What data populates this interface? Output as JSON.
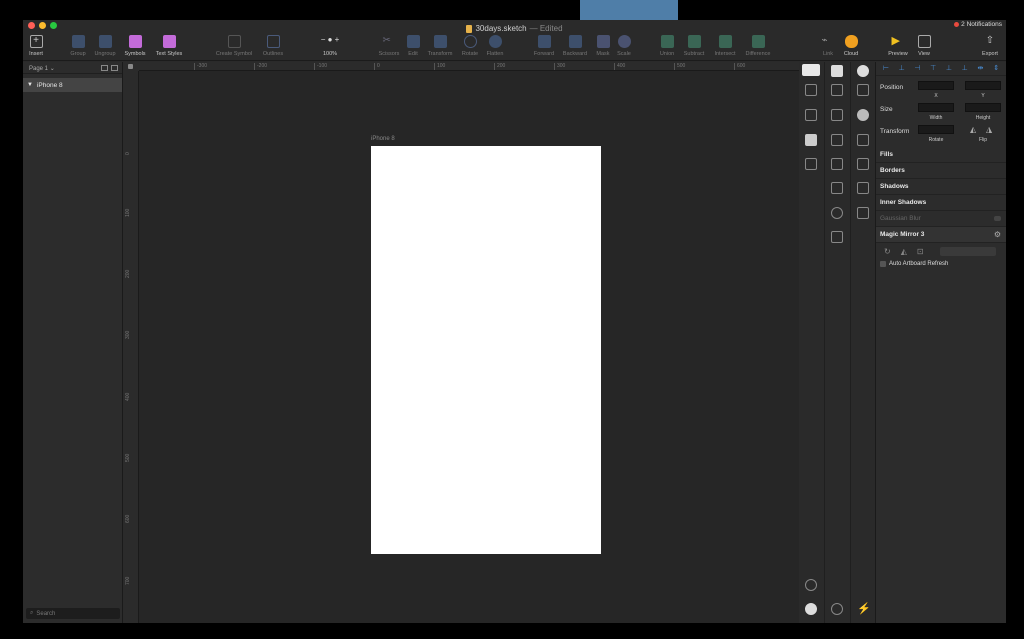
{
  "window": {
    "title": "30days.sketch",
    "title_suffix": "— Edited",
    "notifications": "2 Notifications"
  },
  "toolbar": {
    "insert": "Insert",
    "group": "Group",
    "ungroup": "Ungroup",
    "symbols": "Symbols",
    "text_styles": "Text Styles",
    "create_symbol": "Create Symbol",
    "outlines": "Outlines",
    "zoom": "100%",
    "scissors": "Scissors",
    "edit": "Edit",
    "transform": "Transform",
    "rotate": "Rotate",
    "flatten": "Flatten",
    "forward": "Forward",
    "backward": "Backward",
    "mask": "Mask",
    "scale": "Scale",
    "union": "Union",
    "subtract": "Subtract",
    "intersect": "Intersect",
    "difference": "Difference",
    "link": "Link",
    "cloud": "Cloud",
    "preview": "Preview",
    "view": "View",
    "export": "Export"
  },
  "layers": {
    "page": "Page 1",
    "items": [
      {
        "label": "iPhone 8"
      }
    ],
    "search_placeholder": "Search"
  },
  "canvas": {
    "artboard_label": "iPhone 8",
    "ruler_top": [
      "-300",
      "-200",
      "-100",
      "0",
      "100",
      "200",
      "300",
      "400",
      "500",
      "600"
    ],
    "ruler_left": [
      "0",
      "100",
      "200",
      "300",
      "400",
      "500",
      "600",
      "700"
    ]
  },
  "inspector": {
    "position_label": "Position",
    "x_label": "X",
    "y_label": "Y",
    "size_label": "Size",
    "width_label": "Width",
    "height_label": "Height",
    "transform_label": "Transform",
    "rotate_label": "Rotate",
    "flip_label": "Flip",
    "fills": "Fills",
    "borders": "Borders",
    "shadows": "Shadows",
    "inner_shadows": "Inner Shadows",
    "gaussian_blur": "Gaussian Blur",
    "plugin_title": "Magic Mirror 3",
    "auto_refresh": "Auto Artboard Refresh"
  },
  "colors": {
    "accent": "#4a90d9",
    "close": "#ff5f57",
    "minimize": "#febc2e",
    "zoom": "#28c840",
    "symbols_purple": "#c36bd9",
    "artboard": "#ffffff"
  }
}
